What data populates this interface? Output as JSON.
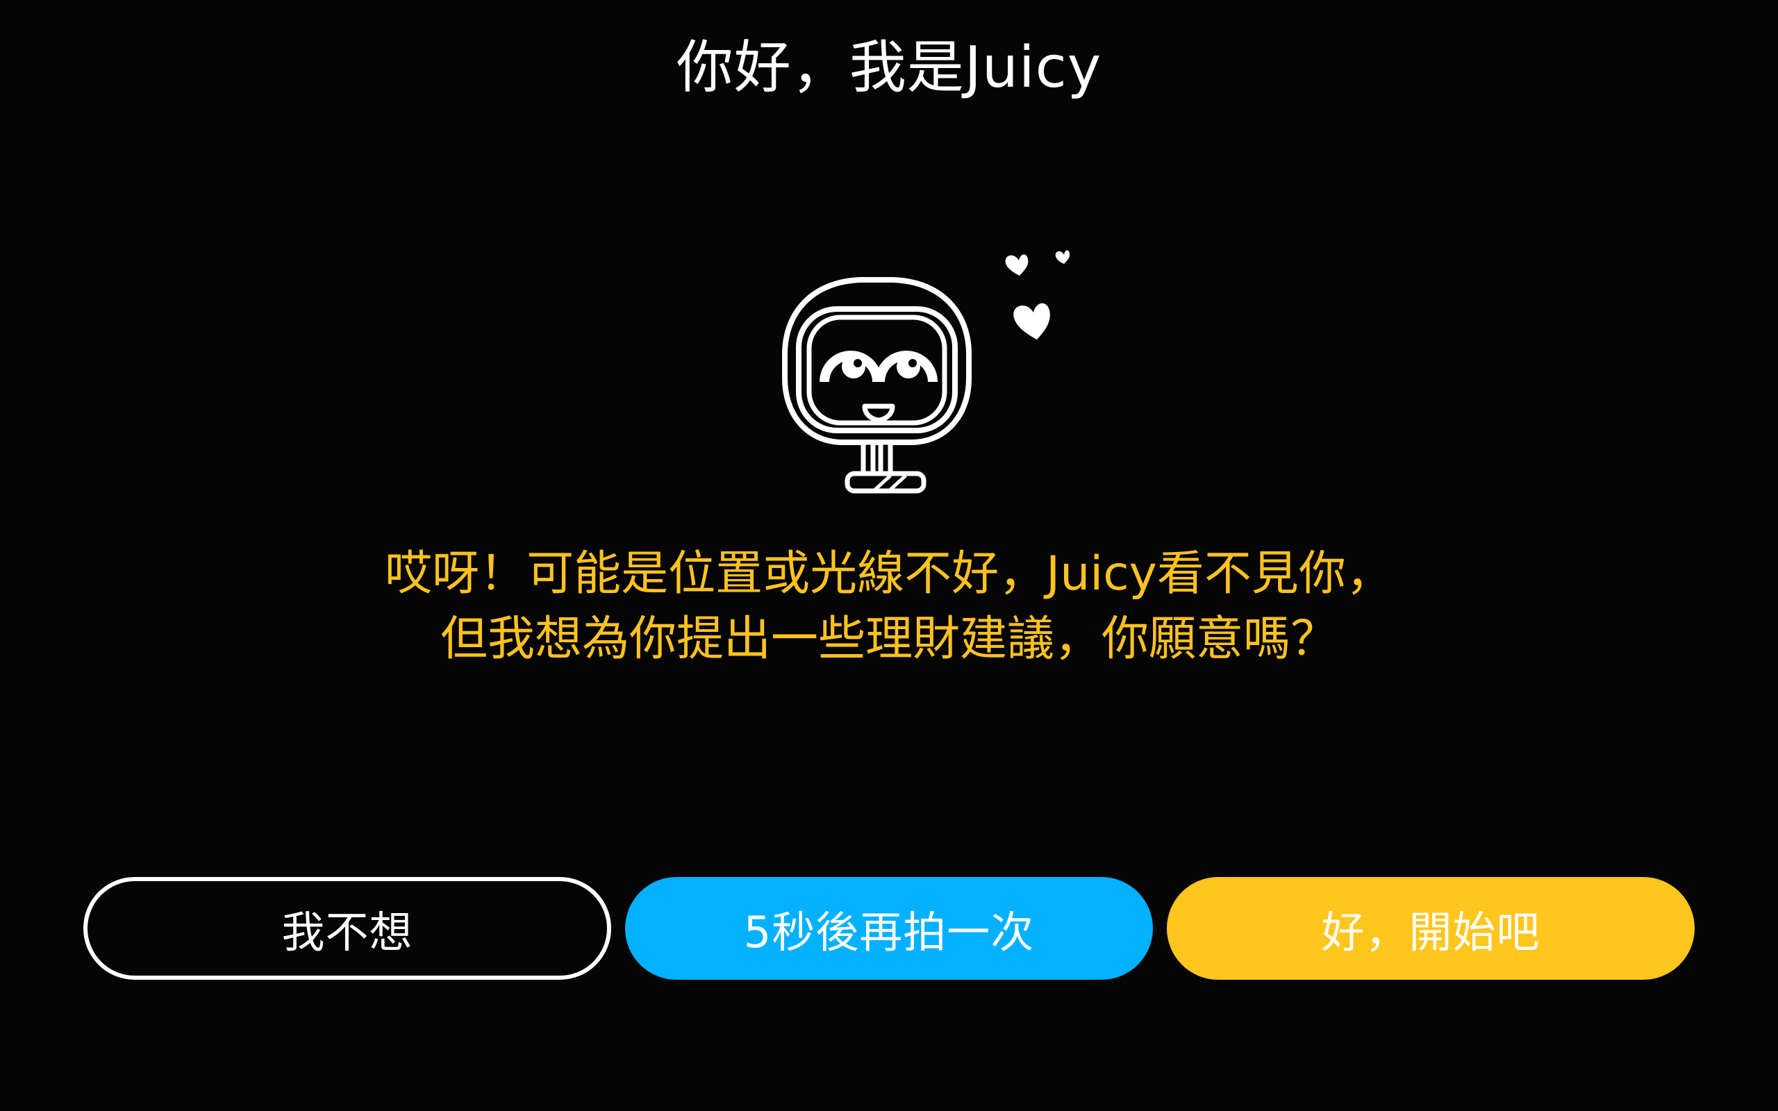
{
  "header": {
    "title": "你好，我是Juicy"
  },
  "mascot": {
    "icon": "juicy-robot-icon",
    "decoration": "heart-icon"
  },
  "message": {
    "line1": "哎呀！可能是位置或光線不好，Juicy看不見你，",
    "line2": "但我想為你提出一些理財建議，你願意嗎？"
  },
  "actions": {
    "decline_label": "我不想",
    "retry_label": "5秒後再拍一次",
    "start_label": "好，開始吧"
  },
  "colors": {
    "background": "#050505",
    "accent_yellow": "#ffc21f",
    "accent_blue": "#03b1ff",
    "text_white": "#ffffff"
  }
}
